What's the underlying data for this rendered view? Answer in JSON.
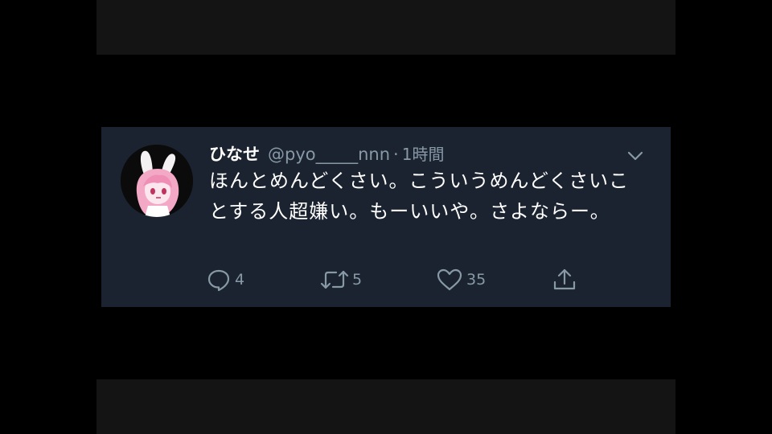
{
  "tweet": {
    "display_name": "ひなせ",
    "handle": "@pyo_____nnn",
    "separator": "·",
    "time": "1時間",
    "text": "ほんとめんどくさい。こういうめんどくさいことする人超嫌い。もーいいや。さよならー。"
  },
  "actions": {
    "reply_count": "4",
    "retweet_count": "5",
    "like_count": "35"
  },
  "icons": {
    "caret": "chevron-down-icon",
    "reply": "reply-icon",
    "retweet": "retweet-icon",
    "like": "heart-icon",
    "share": "share-icon"
  },
  "colors": {
    "background": "#000000",
    "card": "#1b2330",
    "text": "#ffffff",
    "muted": "#8899a6"
  }
}
